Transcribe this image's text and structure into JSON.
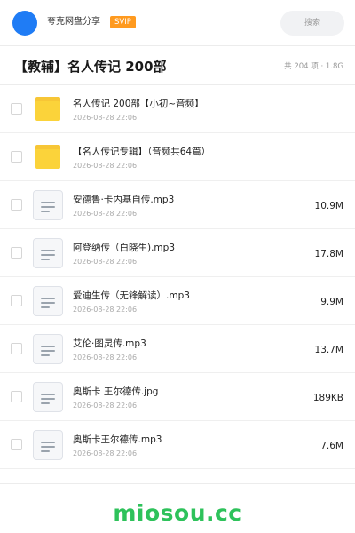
{
  "header": {
    "app_name": "夸克网盘分享",
    "badge": "SVIP",
    "search_placeholder": "搜索"
  },
  "folder": {
    "title": "【教辅】名人传记 200部",
    "meta": "共 204 项 · 1.8G"
  },
  "files": [
    {
      "type": "folder",
      "name": "名人传记 200部【小初~音频】",
      "date": "2026-08-28 22:06",
      "size": ""
    },
    {
      "type": "folder",
      "name": "【名人传记专辑】（音频共64篇）",
      "date": "2026-08-28 22:06",
      "size": ""
    },
    {
      "type": "file",
      "name": "安德鲁·卡内基自传.mp3",
      "date": "2026-08-28 22:06",
      "size": "10.9M"
    },
    {
      "type": "file",
      "name": "阿登纳传（白晓生).mp3",
      "date": "2026-08-28 22:06",
      "size": "17.8M"
    },
    {
      "type": "file",
      "name": "爱迪生传（无锋解读）.mp3",
      "date": "2026-08-28 22:06",
      "size": "9.9M"
    },
    {
      "type": "file",
      "name": "艾伦·图灵传.mp3",
      "date": "2026-08-28 22:06",
      "size": "13.7M"
    },
    {
      "type": "file",
      "name": "奥斯卡 王尔德传.jpg",
      "date": "2026-08-28 22:06",
      "size": "189KB"
    },
    {
      "type": "file",
      "name": "奥斯卡王尔德传.mp3",
      "date": "2026-08-28 22:06",
      "size": "7.6M"
    }
  ],
  "watermark": "miosou.cc",
  "colors": {
    "avatar": "#1f7cf5",
    "badge": "#ff9a1f",
    "folder": "#fbd33a",
    "watermark": "#2ec25b"
  }
}
